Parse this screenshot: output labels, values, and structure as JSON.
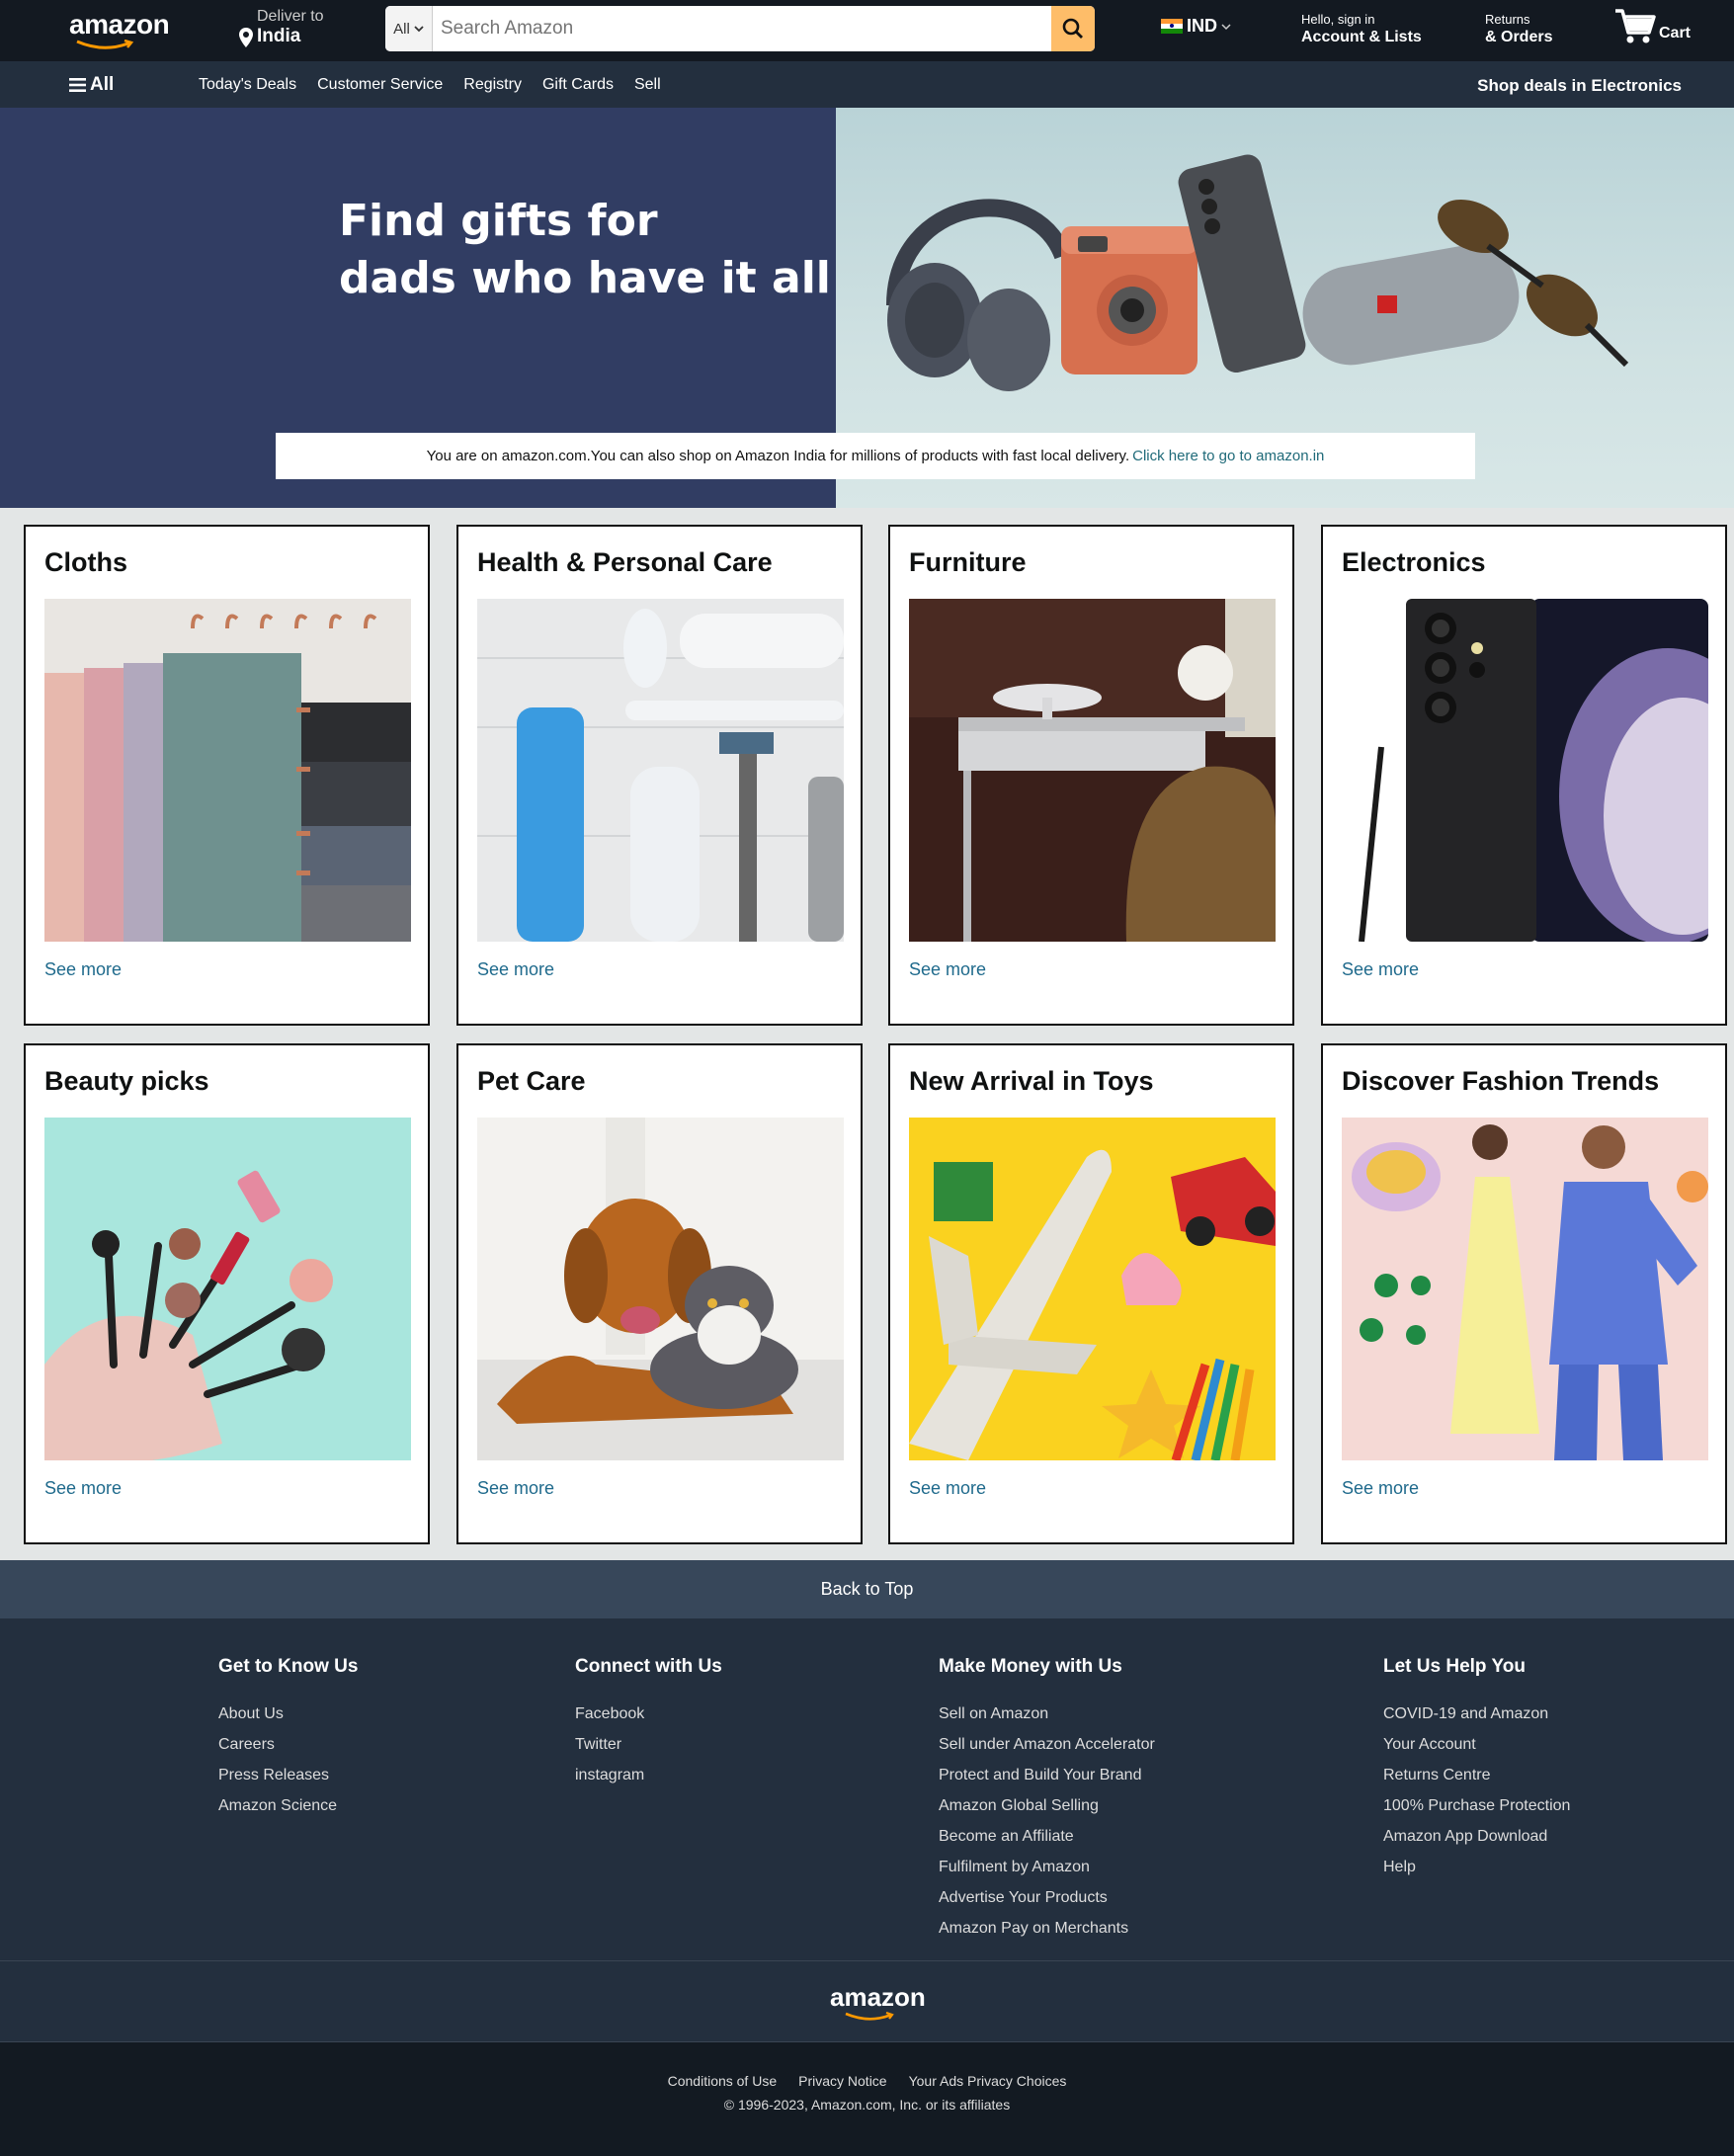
{
  "header": {
    "logo": "amazon",
    "deliver_small": "Deliver to",
    "deliver_big": "India",
    "search_category": "All",
    "search_placeholder": "Search Amazon",
    "lang": "IND",
    "account_small": "Hello, sign in",
    "account_big": "Account & Lists",
    "orders_small": "Returns",
    "orders_big": "& Orders",
    "cart": "Cart"
  },
  "subnav": {
    "all": "All",
    "links": [
      "Today's Deals",
      "Customer Service",
      "Registry",
      "Gift Cards",
      "Sell"
    ],
    "right": "Shop deals in Electronics"
  },
  "hero": {
    "title_line1": "Find gifts for",
    "title_line2": "dads who have it all",
    "notice_text": "You are on amazon.com.You can also shop on Amazon India for millions of products with fast local delivery.",
    "notice_link": "Click here to go to amazon.in"
  },
  "cards": [
    {
      "title": "Cloths",
      "link": "See more",
      "image": "folded-fabrics"
    },
    {
      "title": "Health & Personal Care",
      "link": "See more",
      "image": "toiletries"
    },
    {
      "title": "Furniture",
      "link": "See more",
      "image": "desk-and-chair"
    },
    {
      "title": "Electronics",
      "link": "See more",
      "image": "smartphone"
    },
    {
      "title": "Beauty picks",
      "link": "See more",
      "image": "makeup-bag"
    },
    {
      "title": "Pet Care",
      "link": "See more",
      "image": "dog-and-cat"
    },
    {
      "title": "New Arrival in Toys",
      "link": "See more",
      "image": "toy-plane"
    },
    {
      "title": "Discover Fashion Trends",
      "link": "See more",
      "image": "fashion-models"
    }
  ],
  "footer": {
    "back_to_top": "Back to Top",
    "columns": [
      {
        "title": "Get to Know Us",
        "links": [
          "About Us",
          "Careers",
          "Press Releases",
          "Amazon Science"
        ]
      },
      {
        "title": "Connect with Us",
        "links": [
          "Facebook",
          "Twitter",
          "instagram"
        ]
      },
      {
        "title": "Make Money with Us",
        "links": [
          "Sell on Amazon",
          "Sell under Amazon Accelerator",
          "Protect and Build Your Brand",
          "Amazon Global Selling",
          "Become an Affiliate",
          "Fulfilment by Amazon",
          "Advertise Your Products",
          "Amazon Pay on Merchants"
        ]
      },
      {
        "title": "Let Us Help You",
        "links": [
          "COVID-19 and Amazon",
          "Your Account",
          "Returns Centre",
          "100% Purchase Protection",
          "Amazon App Download",
          "Help"
        ]
      }
    ],
    "logo": "amazon",
    "bottom_links": [
      "Conditions of Use",
      "Privacy Notice",
      "Your Ads Privacy Choices"
    ],
    "copyright": "© 1996-2023, Amazon.com, Inc. or its affiliates"
  },
  "colors": {
    "nav_dark": "#131921",
    "nav_sub": "#232f3e",
    "search_button": "#febd69",
    "link": "#1f6a8c",
    "hero_left": "#313d63"
  }
}
